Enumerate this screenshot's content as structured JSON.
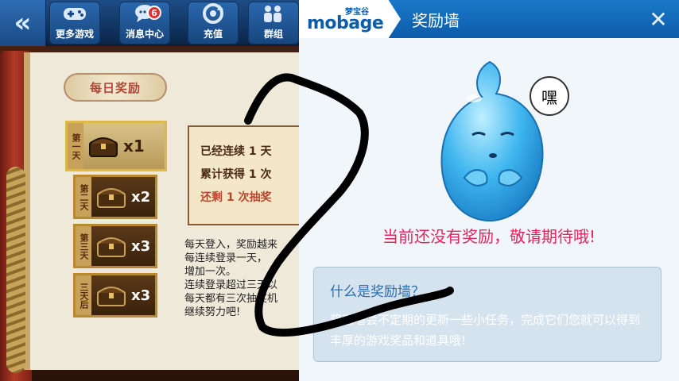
{
  "game": {
    "back_glyph": "«",
    "nav": [
      {
        "label": "更多游戏",
        "icon": "gamepad-icon"
      },
      {
        "label": "消息中心",
        "icon": "message-icon",
        "badge": "6"
      },
      {
        "label": "充值",
        "icon": "recharge-icon"
      },
      {
        "label": "群组",
        "icon": "group-icon"
      }
    ],
    "panel_title": "每日奖励",
    "days": [
      {
        "day": "第一天",
        "count": "x1"
      },
      {
        "day": "第二天",
        "count": "x2"
      },
      {
        "day": "第三天",
        "count": "x3"
      },
      {
        "day": "三天后",
        "count": "x3"
      }
    ],
    "status": [
      "已经连续 1 天",
      "累计获得 1 次",
      "还剩 1 次抽奖"
    ],
    "rules": [
      "每天登入，奖励越来",
      "每连续登录一天，",
      "增加一次。",
      "连续登录超过三天以",
      "每天都有三次抽奖机",
      "继续努力吧!"
    ]
  },
  "wall": {
    "logo_cn": "梦宝谷",
    "logo_en": "mobage",
    "title": "奖励墙",
    "close_glyph": "✕",
    "mascot_bubble": "嘿",
    "empty_message": "当前还没有奖励，敬请期待哦!",
    "info_title": "什么是奖励墙？",
    "info_body": "奖励墙会不定期的更新一些小任务，完成它们您就可以得到丰厚的游戏奖品和道具哦!"
  },
  "colors": {
    "header_blue": "#0c5ca9",
    "accent_pink": "#e8245c",
    "info_title_blue": "#2a6db0",
    "badge_red": "#e23030"
  }
}
